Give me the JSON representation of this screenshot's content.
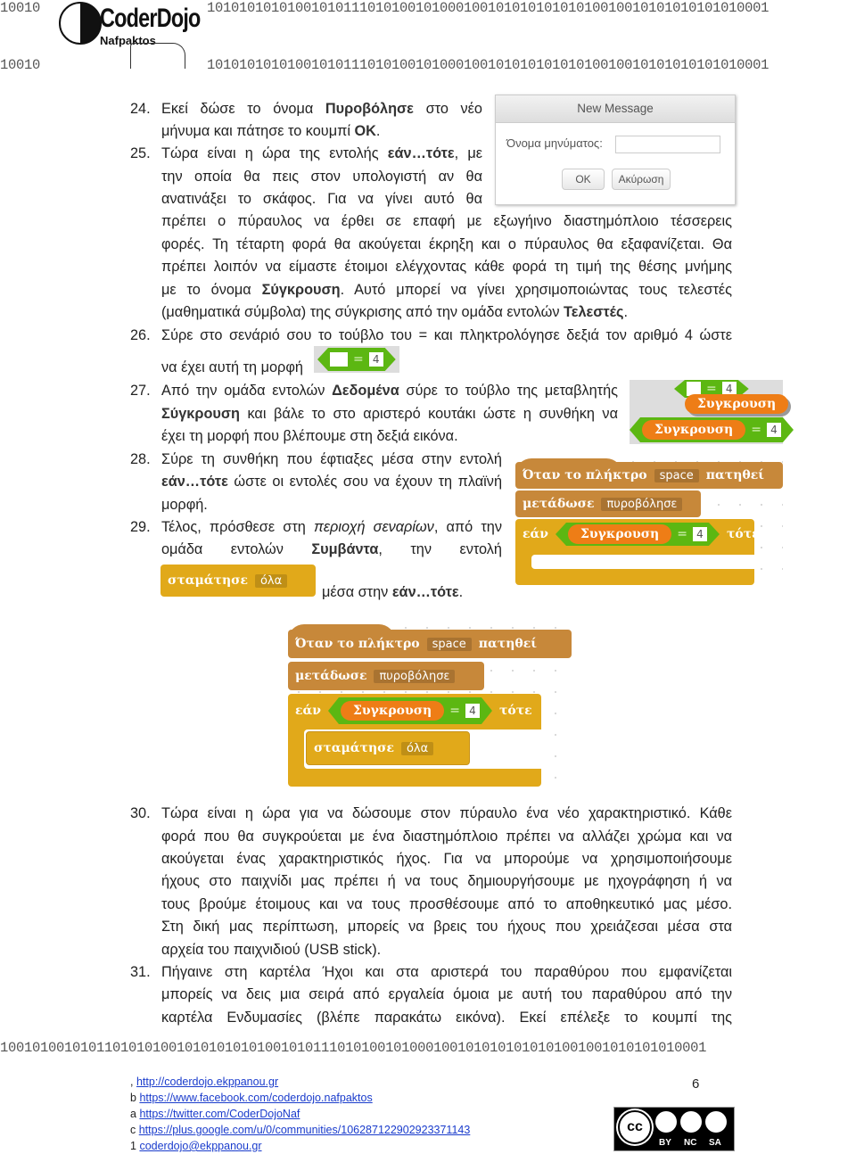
{
  "header": {
    "prefix": "10010",
    "binary": "1010101010100101011101010010100010010101010101010010010101010101010001",
    "logo_text": "CoderDojo",
    "logo_sub": "Nafpaktos"
  },
  "items": [
    {
      "num": "24.",
      "lines": [
        [
          "Εκεί δώσε το όνομα ",
          {
            "b": "Πυροβόλησε"
          },
          " στο νέο"
        ],
        [
          "μήνυμα και πάτησε το κουμπί ",
          {
            "b": "OK"
          },
          "."
        ]
      ]
    },
    {
      "num": "25.",
      "lines": [
        [
          "Τώρα είναι η ώρα της εντολής ",
          {
            "b": "εάν…τότε"
          },
          ", με"
        ],
        [
          "την οποία θα πεις στον υπολογιστή αν θα"
        ],
        [
          "ανατινάξει το σκάφος. Για να γίνει αυτό θα"
        ],
        [
          "πρέπει ο πύραυλος να έρθει σε επαφή με εξωγήινο διαστημόπλοιο τέσσερεις"
        ],
        [
          "φορές. Τη τέταρτη φορά θα ακούγεται έκρηξη και ο πύραυλος θα εξαφανίζεται. Θα"
        ],
        [
          "πρέπει λοιπόν να είμαστε έτοιμοι ελέγχοντας κάθε φορά τη τιμή της θέσης μνήμης"
        ],
        [
          "με το όνομα ",
          {
            "b": "Σύγκρουση"
          },
          ". Αυτό μπορεί να γίνει χρησιμοποιώντας τους τελεστές"
        ],
        [
          "(μαθηματικά σύμβολα) της σύγκρισης από την ομάδα εντολών ",
          {
            "b": "Τελεστές"
          },
          "."
        ]
      ]
    },
    {
      "num": "26.",
      "lines": [
        [
          "Σύρε στο σενάριό σου το τούβλο του = και πληκτρολόγησε δεξιά τον αριθμό 4 ώστε"
        ],
        [
          "να έχει αυτή τη μορφή"
        ],
        [
          "."
        ]
      ]
    },
    {
      "num": "27.",
      "lines": [
        [
          "Από την ομάδα εντολών ",
          {
            "b": "Δεδομένα"
          },
          " σύρε το τούβλο της μεταβλητής"
        ],
        [
          {
            "b": "Σύγκρουση"
          },
          " και βάλε το στο αριστερό κουτάκι ώστε η συνθήκη να"
        ],
        [
          "έχει τη μορφή που βλέπουμε στη δεξιά εικόνα."
        ]
      ]
    },
    {
      "num": "28.",
      "lines": [
        [
          "Σύρε τη συνθήκη που έφτιαξες μέσα στην εντολή"
        ],
        [
          {
            "b": "εάν…τότε"
          },
          " ώστε οι εντολές σου να έχουν τη πλαϊνή"
        ],
        [
          "μορφή."
        ]
      ]
    },
    {
      "num": "29.",
      "lines": [
        [
          "Τέλος, πρόσθεσε στη ",
          {
            "i": "περιοχή σεναρίων"
          },
          ", από την"
        ],
        [
          "ομάδα εντολών ",
          {
            "b": "Συμβάντα"
          },
          ", την εντολή"
        ],
        [
          "μέσα στην ",
          {
            "b": "εάν…τότε"
          },
          "."
        ]
      ]
    },
    {
      "num": "30.",
      "lines": [
        [
          "Τώρα είναι η ώρα για να δώσουμε στον πύραυλο ένα νέο χαρακτηριστικό. Κάθε"
        ],
        [
          "φορά που θα συγκρούεται με ένα διαστημόπλοιο πρέπει να αλλάζει χρώμα και να"
        ],
        [
          "ακούγεται ένας χαρακτηριστικός ήχος. Για να μπορούμε να χρησιμοποιήσουμε"
        ],
        [
          "ήχους στο παιχνίδι μας πρέπει ή να τους δημιουργήσουμε με ηχογράφηση ή να"
        ],
        [
          "τους βρούμε έτοιμους και να τους προσθέσουμε από το αποθηκευτικό μας μέσο."
        ],
        [
          "Στη δική μας περίπτωση, μπορείς να βρεις του ήχους που χρειάζεσαι μέσα στα"
        ],
        [
          "αρχεία του παιχνιδιού (USB stick)."
        ]
      ]
    },
    {
      "num": "31.",
      "lines": [
        [
          "Πήγαινε στη καρτέλα Ήχοι και στα αριστερά του παραθύρου που εμφανίζεται"
        ],
        [
          "μπορείς να δεις μια σειρά από εργαλεία όμοια με αυτή του παραθύρου από την"
        ],
        [
          "καρτέλα Ενδυμασίες (βλέπε παρακάτω εικόνα). Εκεί επέλεξε το κουμπί της"
        ]
      ]
    }
  ],
  "dialog": {
    "title": "New Message",
    "label": "Όνομα μηνύματος:",
    "value": "",
    "ok": "OK",
    "cancel": "Ακύρωση"
  },
  "blocks": {
    "when_key": "Όταν το πλήκτρο",
    "key": "space",
    "pressed": "πατηθεί",
    "broadcast": "μετάδωσε",
    "message": "πυροβόλησε",
    "if": "εάν",
    "then": "τότε",
    "variable": "Συγκρουση",
    "eq": "=",
    "value": "4",
    "stop": "σταμάτησε",
    "stop_opt": "όλα"
  },
  "footer": {
    "binary": "1001010010101101010100101010101010010101110101001010001001010101010101001001010101010001",
    "links": [
      {
        "prefix": ",",
        "text": "http://coderdojo.ekppanou.gr"
      },
      {
        "prefix": "b",
        "text": "https://www.facebook.com/coderdojo.nafpaktos"
      },
      {
        "prefix": "a",
        "text": "https://twitter.com/CoderDojoNaf"
      },
      {
        "prefix": "c",
        "text": "https://plus.google.com/u/0/communities/106287122902923371143"
      },
      {
        "prefix": "1",
        "text": "coderdojo@ekppanou.gr"
      }
    ],
    "page": "6",
    "license": {
      "cc": "cc",
      "by": "BY",
      "nc": "NC",
      "sa": "SA"
    }
  }
}
